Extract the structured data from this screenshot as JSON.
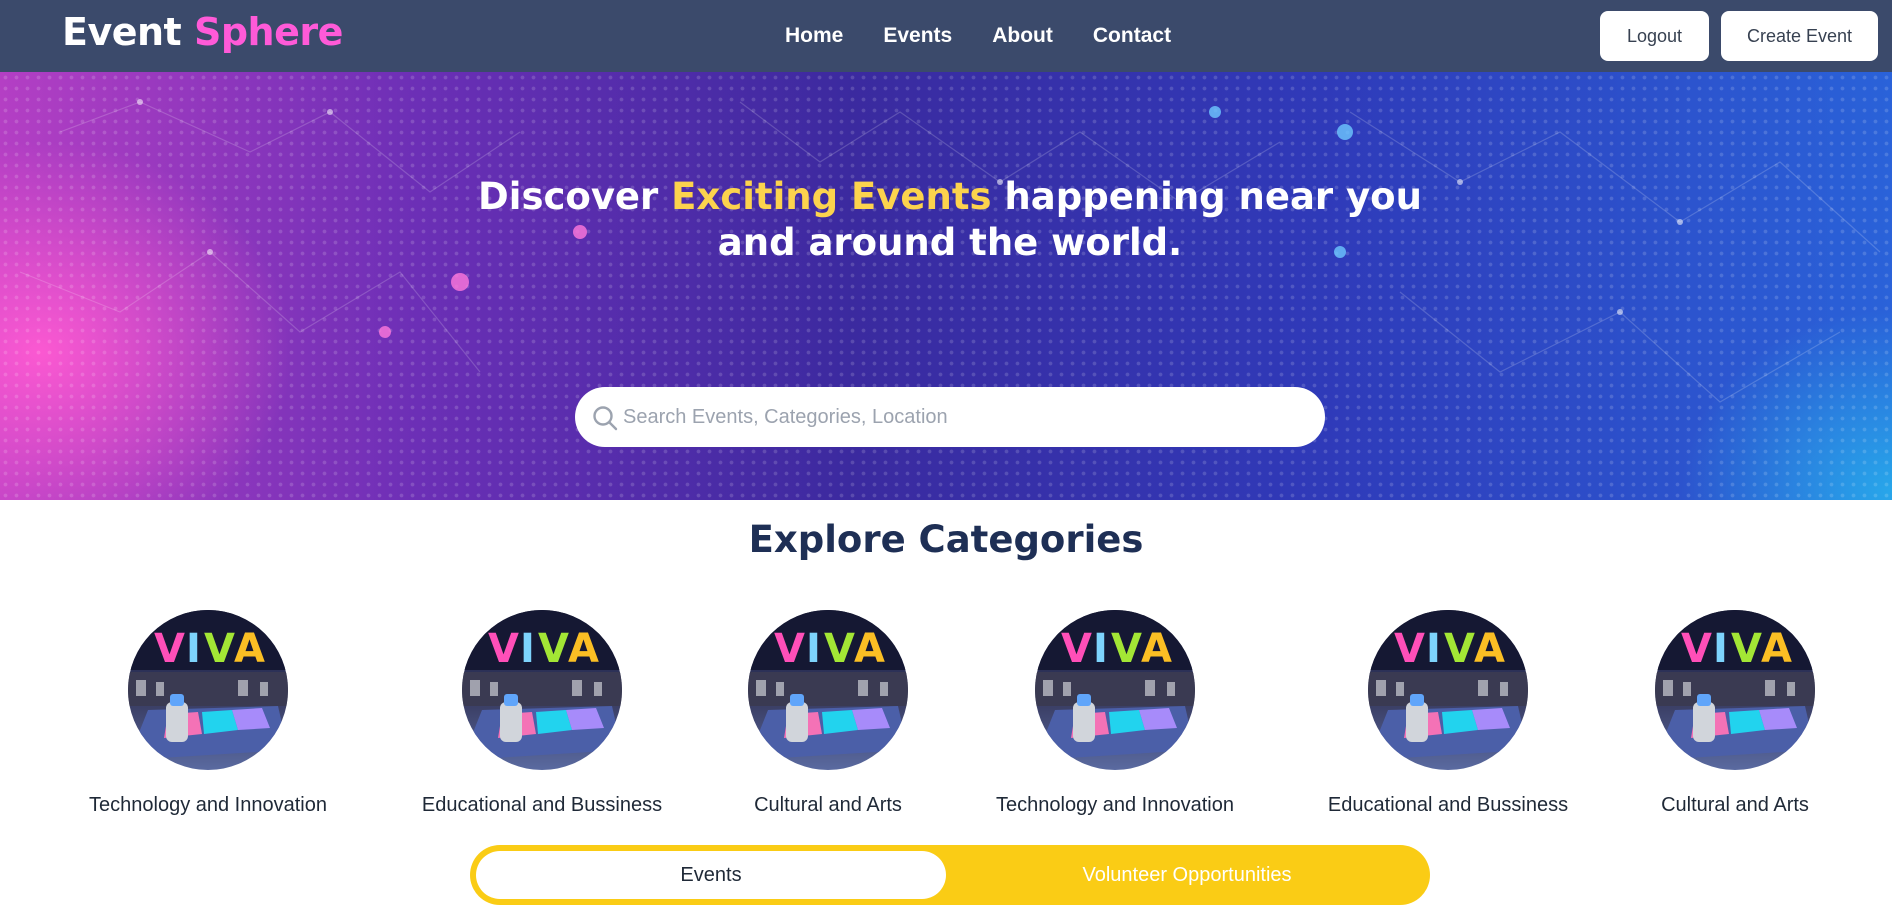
{
  "brand": {
    "part1": "Event",
    "part2": "Sphere"
  },
  "nav": {
    "links": [
      "Home",
      "Events",
      "About",
      "Contact"
    ],
    "logout_label": "Logout",
    "create_label": "Create Event"
  },
  "hero": {
    "title_pre": "Discover ",
    "title_highlight": "Exciting Events",
    "title_post": " happening near you and around the world.",
    "search_placeholder": "Search Events, Categories, Location"
  },
  "categories": {
    "heading": "Explore Categories",
    "items": [
      {
        "label": "Technology and Innovation"
      },
      {
        "label": "Educational and Bussiness"
      },
      {
        "label": "Cultural and Arts"
      },
      {
        "label": "Technology and Innovation"
      },
      {
        "label": "Educational and Bussiness"
      },
      {
        "label": "Cultural and Arts"
      }
    ]
  },
  "toggle": {
    "events_label": "Events",
    "volunteer_label": "Volunteer Opportunities"
  },
  "colors": {
    "navbar": "#3b4a6b",
    "brand_accent": "#ff5ad8",
    "highlight": "#fcd34d",
    "toggle": "#facc15",
    "heading": "#1e2f55"
  },
  "icons": {
    "search": "search-icon"
  }
}
